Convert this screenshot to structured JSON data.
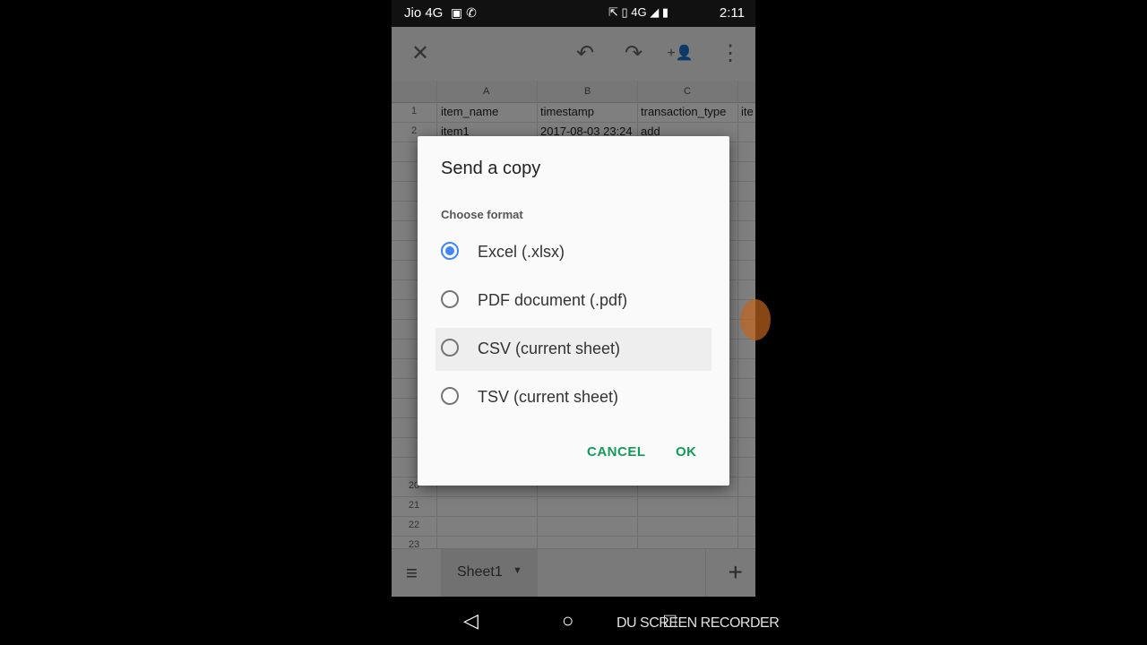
{
  "status_bar": {
    "carrier": "Jio 4G",
    "left_icons": "▣ ✆",
    "right_icons": "⇱ ▯ 4G ◢ ▮",
    "time": "2:11"
  },
  "toolbar": {
    "close_icon": "✕",
    "undo_icon": "↶",
    "redo_icon": "↷",
    "share_icon": "+👤",
    "more_icon": "⋮"
  },
  "sheet": {
    "columns": [
      "A",
      "B",
      "C"
    ],
    "rows": [
      {
        "num": "1",
        "a": "item_name",
        "b": "timestamp",
        "c": "transaction_type",
        "d": "ite"
      },
      {
        "num": "2",
        "a": "item1",
        "b": "2017-08-03 23:24",
        "c": "add",
        "d": ""
      },
      {
        "num": "20",
        "a": "",
        "b": "",
        "c": "",
        "d": ""
      },
      {
        "num": "21",
        "a": "",
        "b": "",
        "c": "",
        "d": ""
      },
      {
        "num": "22",
        "a": "",
        "b": "",
        "c": "",
        "d": ""
      },
      {
        "num": "23",
        "a": "",
        "b": "",
        "c": "",
        "d": ""
      }
    ]
  },
  "tabs_bar": {
    "menu_icon": "≡",
    "sheet_tab": "Sheet1",
    "caret": "▼",
    "add_icon": "+"
  },
  "dialog": {
    "title": "Send a copy",
    "subtitle": "Choose format",
    "options": [
      {
        "label": "Excel (.xlsx)",
        "checked": true
      },
      {
        "label": "PDF document (.pdf)",
        "checked": false
      },
      {
        "label": "CSV (current sheet)",
        "checked": false
      },
      {
        "label": "TSV (current sheet)",
        "checked": false
      }
    ],
    "cancel_label": "CANCEL",
    "ok_label": "OK",
    "accent_color": "#4285f4",
    "button_color": "#0f9d58"
  },
  "nav_bar": {
    "back_icon": "◁",
    "home_icon": "○",
    "recents_icon": "□"
  },
  "watermark": "DU SCREEN RECORDER"
}
